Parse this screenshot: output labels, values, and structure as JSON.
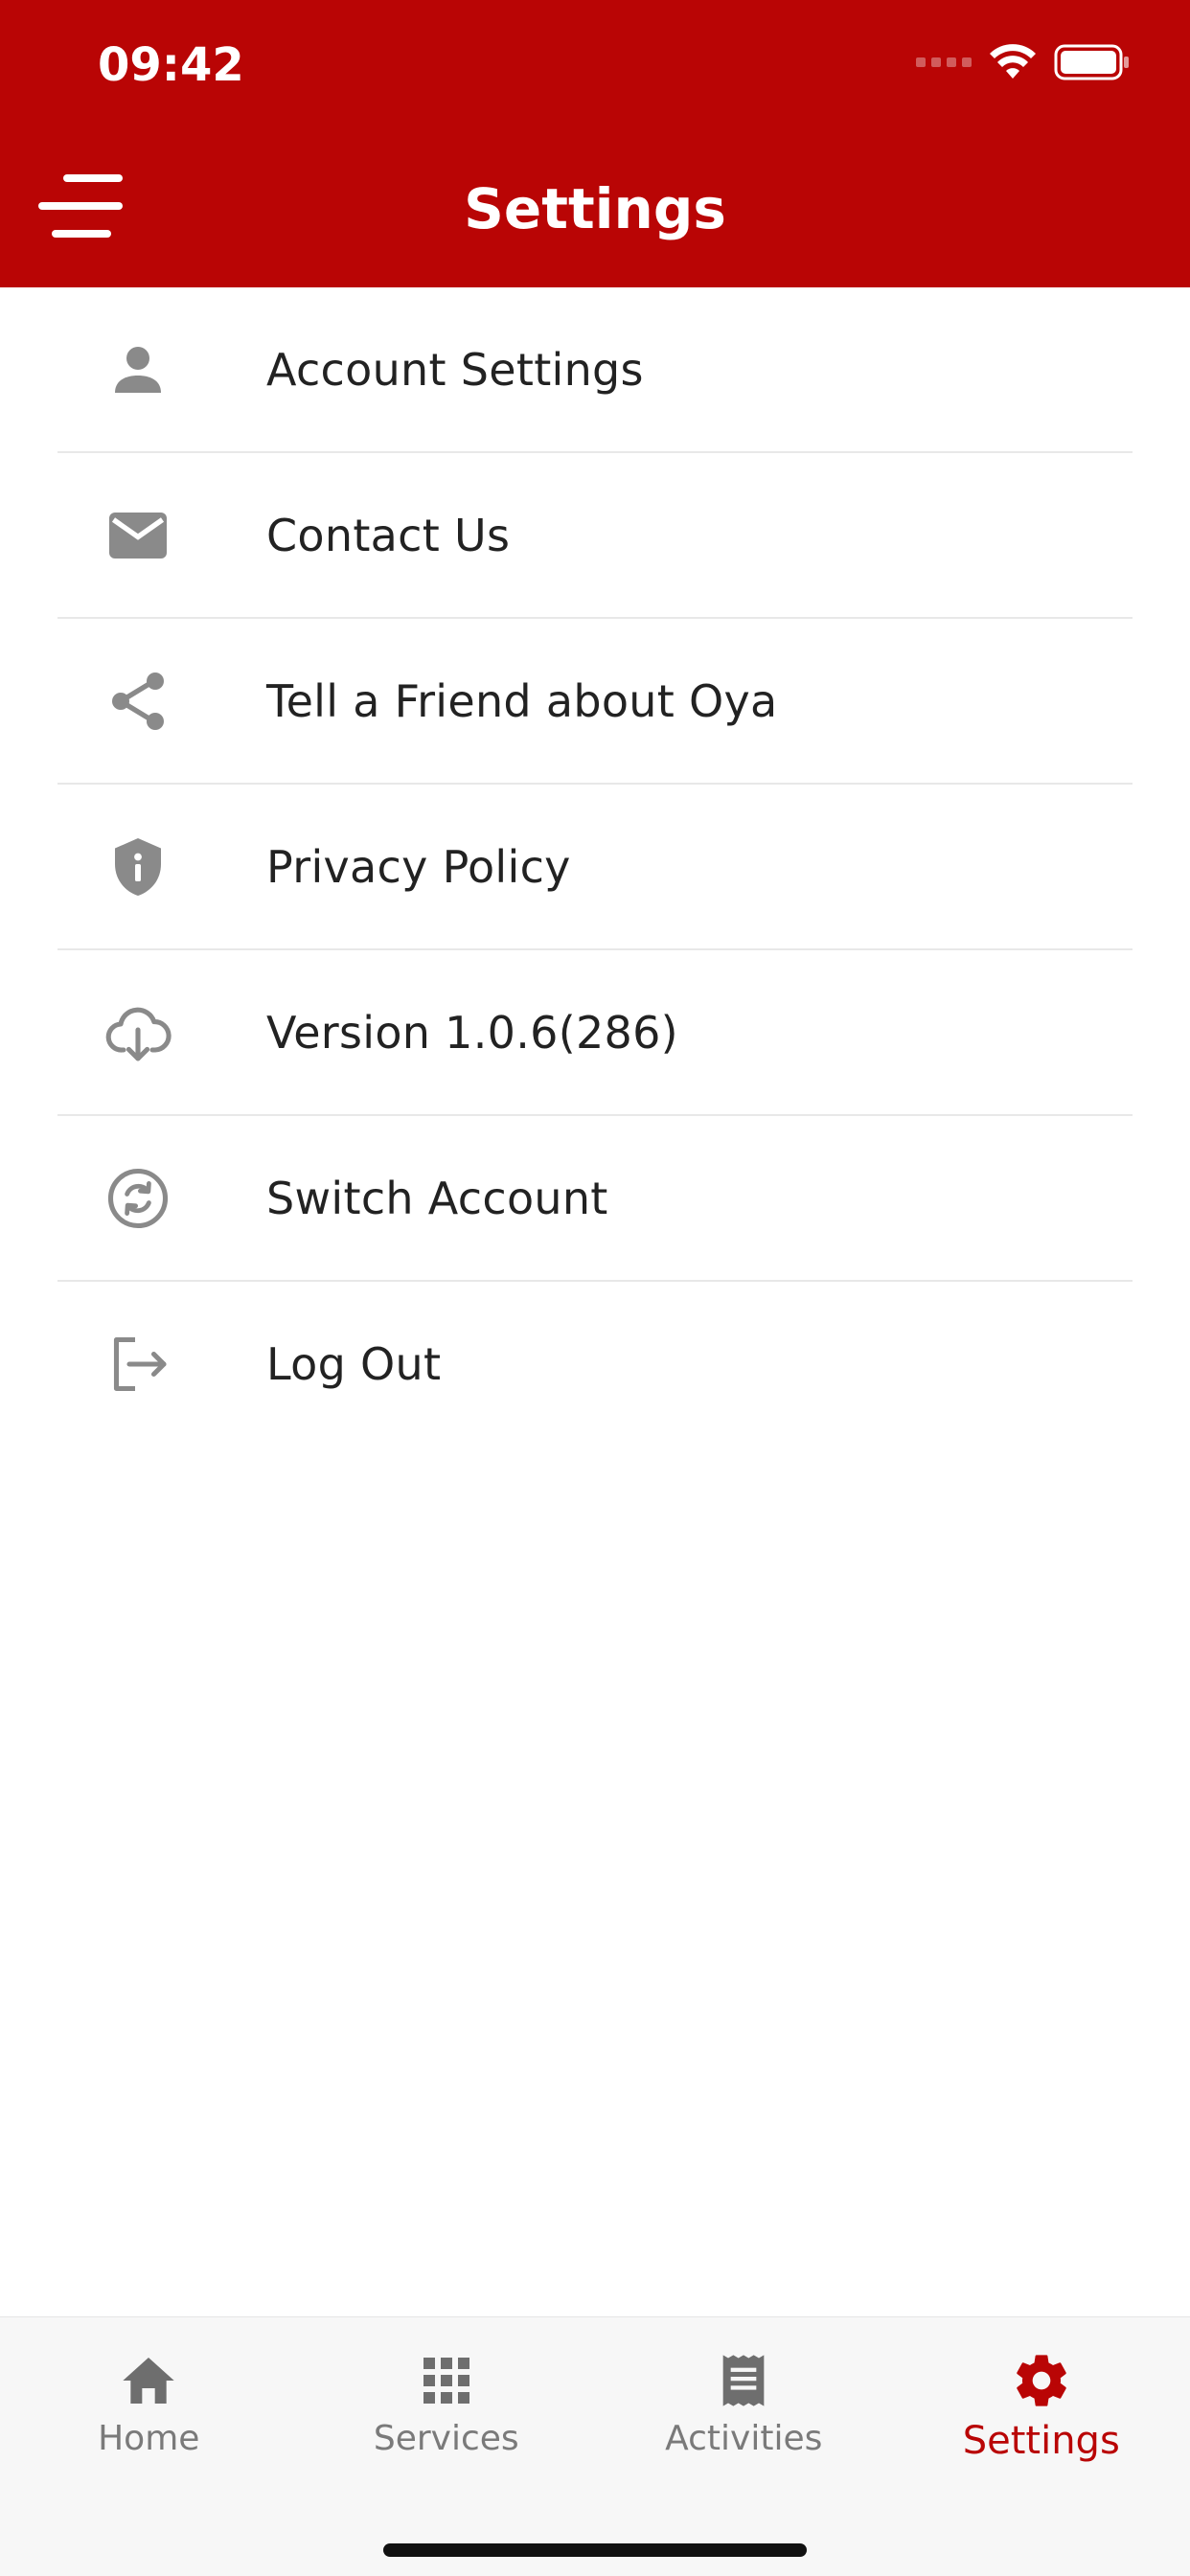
{
  "status_bar": {
    "time": "09:42"
  },
  "header": {
    "title": "Settings",
    "menu_icon": "hamburger-menu-icon"
  },
  "settings_items": [
    {
      "label": "Account Settings",
      "icon": "person-icon"
    },
    {
      "label": "Contact Us",
      "icon": "mail-icon"
    },
    {
      "label": "Tell a Friend about Oya",
      "icon": "share-icon"
    },
    {
      "label": "Privacy Policy",
      "icon": "shield-info-icon"
    },
    {
      "label": "Version 1.0.6(286)",
      "icon": "cloud-download-icon"
    },
    {
      "label": "Switch Account",
      "icon": "switch-account-icon"
    },
    {
      "label": "Log Out",
      "icon": "logout-icon"
    }
  ],
  "bottom_nav": {
    "items": [
      {
        "label": "Home",
        "icon": "home-icon"
      },
      {
        "label": "Services",
        "icon": "grid-icon"
      },
      {
        "label": "Activities",
        "icon": "receipt-icon"
      },
      {
        "label": "Settings",
        "icon": "gear-icon"
      }
    ],
    "active": "Settings"
  },
  "colors": {
    "brand_red": "#B90505",
    "icon_gray": "#8A8A8A",
    "text": "#222222",
    "nav_inactive": "#7A7A7A"
  }
}
